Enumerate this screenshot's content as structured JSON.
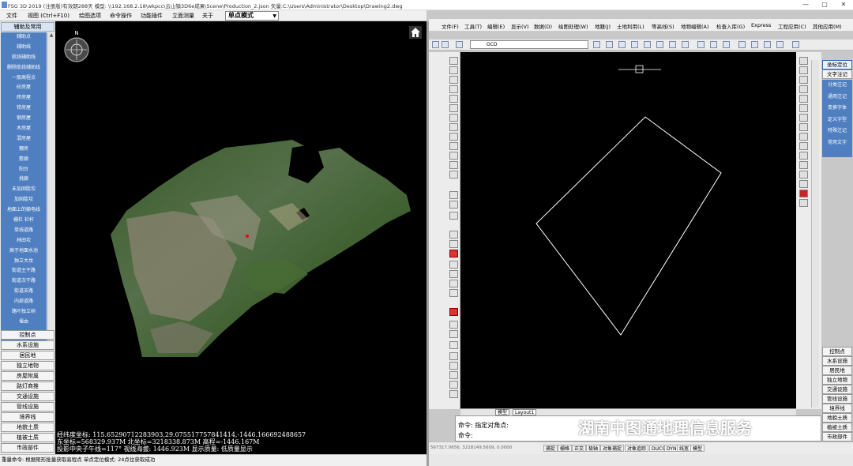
{
  "app": {
    "title": "FSG 3D 2019 (注册版)有效期288天 模型: \\\\192.168.2.18\\wkpcc\\云山镇3D6e成果\\Scene\\Production_2.json 矢量:C:\\Users\\Administrator\\Desktop\\Drawing2.dwg"
  },
  "left_menu": {
    "items": [
      "文件",
      "视图 (Ctrl+F10)",
      "绘图选项",
      "命令操作",
      "功能插件",
      "立面测量",
      "关于"
    ],
    "mode_value": "单点模式"
  },
  "left_panel": {
    "header": "辅助及常用",
    "categories": [
      "辅助点",
      "辅助线",
      "航线辅助线",
      "删除航线辅助线",
      "一般高程点",
      "砼房屋",
      "砖房屋",
      "铁房屋",
      "钢房屋",
      "木房屋",
      "混房屋",
      "棚房",
      "簷廊",
      "阳台",
      "挑廊",
      "未加固陡坎",
      "加固陡坎",
      "地面上的输电线",
      "栅栏 栏杆",
      "单线道路",
      "林田坎",
      "高于地面水池",
      "独立大坟",
      "街道主干路",
      "街道次干路",
      "街道支路",
      "内部道路",
      "路叶独立树",
      "堰由"
    ],
    "groups": [
      "控制点",
      "水系设施",
      "居民地",
      "独立地物",
      "房屋附属",
      "路灯商推",
      "交通设施",
      "管线设施",
      "境界线",
      "地貌土质",
      "植被土质",
      "市政部件"
    ]
  },
  "viewer": {
    "readout_lines": [
      "经纬度坐标: 115.65290712283903,29.075517757841414,-1446.166692488657",
      "东坐标=568329.937M  北坐标=3218338.873M  高程=-1446.167M",
      "投影中央子午线=117°   视线海拔: 1446.923M  显示质量: 低质量显示"
    ]
  },
  "left_status": "重量命令: 根据矩形批量获取高程点 单点定位模式: 24点位获取成功",
  "cad": {
    "menu": [
      "文件(F)",
      "工具(T)",
      "编辑(E)",
      "显示(V)",
      "数据(D)",
      "绘图处理(W)",
      "地籍(J)",
      "土地利用(L)",
      "等高线(S)",
      "地物编辑(A)",
      "检查入库(G)",
      "Express",
      "工程应用(C)",
      "其他应用(M)"
    ],
    "layer_name": "GCD",
    "tabs": [
      "模型",
      "Layout1"
    ],
    "command_lines": [
      "命令: 指定对角点:",
      "命令:"
    ],
    "coords": "567317.0656, 3218149.5609, 0.0000",
    "status_buttons": [
      "捕捉",
      "栅格",
      "正交",
      "极轴",
      "对象捕捉",
      "对象追踪",
      "DUCS",
      "DYN",
      "线宽",
      "模型"
    ]
  },
  "right_panel": {
    "top_buttons": [
      "坐标定位",
      "文字注记"
    ],
    "categories": [
      "分类注记",
      "通用注记",
      "变换字体",
      "定义字型",
      "特殊注记",
      "常用文字"
    ],
    "groups": [
      "控制点",
      "水系设施",
      "居民地",
      "独立地物",
      "交通设施",
      "管线设施",
      "境界线",
      "地貌土质",
      "植被土质",
      "市政部件"
    ]
  },
  "watermark": "湖南中图通地理信息服务",
  "colors": {
    "panel_blue": "#4f7fc0",
    "viewer_bg": "#000000"
  }
}
